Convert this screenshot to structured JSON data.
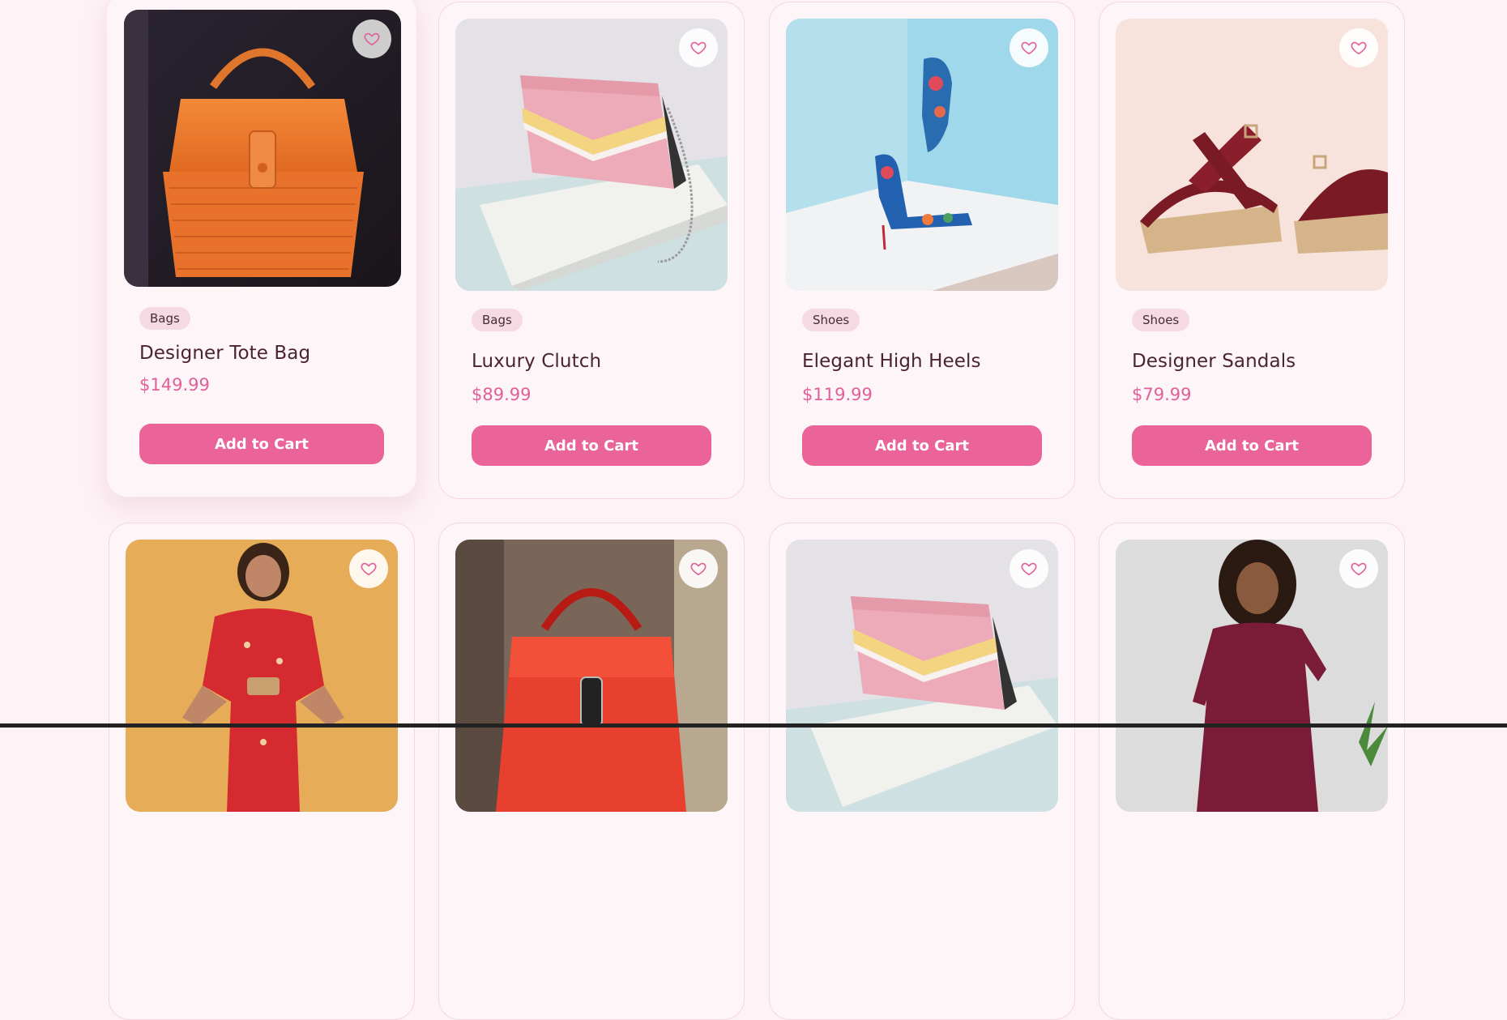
{
  "products": [
    {
      "category": "Bags",
      "name": "Designer Tote Bag",
      "price": "$149.99",
      "cta": "Add to Cart"
    },
    {
      "category": "Bags",
      "name": "Luxury Clutch",
      "price": "$89.99",
      "cta": "Add to Cart"
    },
    {
      "category": "Shoes",
      "name": "Elegant High Heels",
      "price": "$119.99",
      "cta": "Add to Cart"
    },
    {
      "category": "Shoes",
      "name": "Designer Sandals",
      "price": "$79.99",
      "cta": "Add to Cart"
    },
    {
      "category": "",
      "name": "",
      "price": "",
      "cta": ""
    },
    {
      "category": "",
      "name": "",
      "price": "",
      "cta": ""
    },
    {
      "category": "",
      "name": "",
      "price": "",
      "cta": ""
    },
    {
      "category": "",
      "name": "",
      "price": "",
      "cta": ""
    }
  ],
  "icons": {
    "favorite": "heart-outline-icon"
  },
  "colors": {
    "accent": "#ea6499",
    "price": "#e0609a",
    "background": "#fdf2f6",
    "badge": "#f5d9e3",
    "title": "#4a2434"
  }
}
